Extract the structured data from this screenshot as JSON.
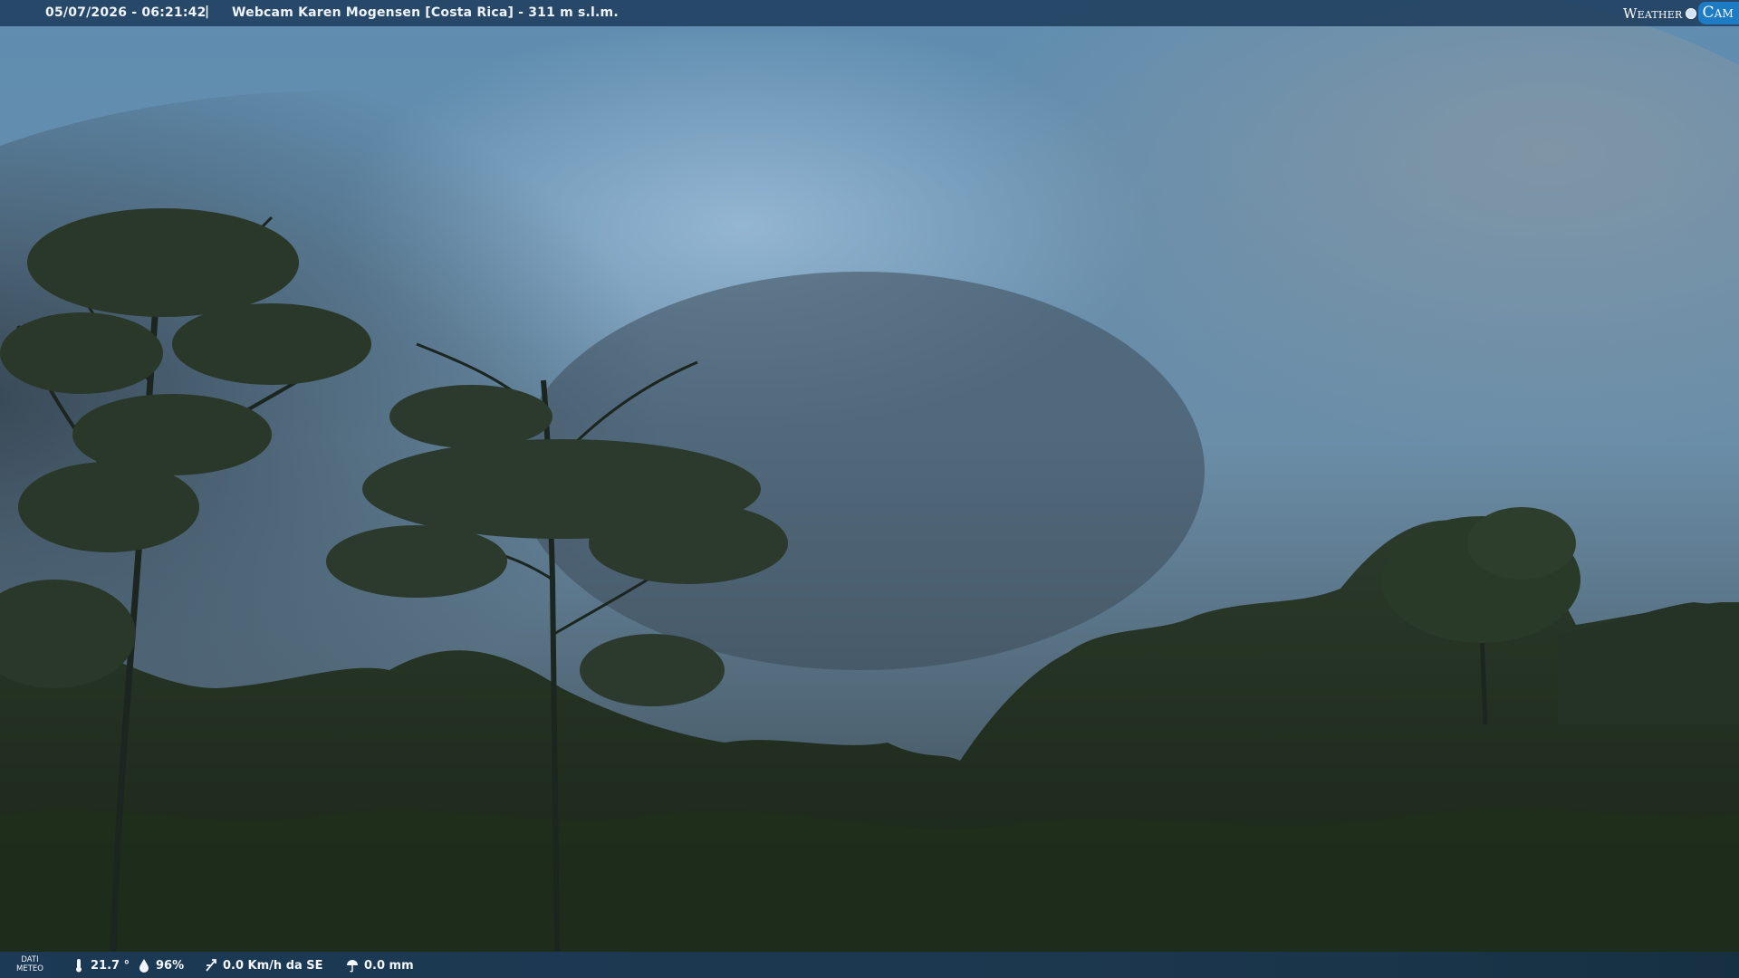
{
  "overlay": {
    "datetime": "05/07/2026 - 06:21:42",
    "separator": "|",
    "title": "Webcam Karen Mogensen [Costa Rica] - 311 m s.l.m.",
    "logo_weather": "Weather",
    "logo_cam": "Cam"
  },
  "meteo": {
    "label_line1": "DATI",
    "label_line2": "METEO",
    "temperature": "21.7 °",
    "humidity": "96%",
    "wind": "0.0 Km/h da SE",
    "rain": "0.0 mm"
  },
  "colors": {
    "sky_top": "#5b8aa9",
    "sky_clouds": "#6e879a",
    "forest_dark": "#1e2b1d",
    "bar_blue": "#234262",
    "logo_blue": "#1d7cc4"
  }
}
